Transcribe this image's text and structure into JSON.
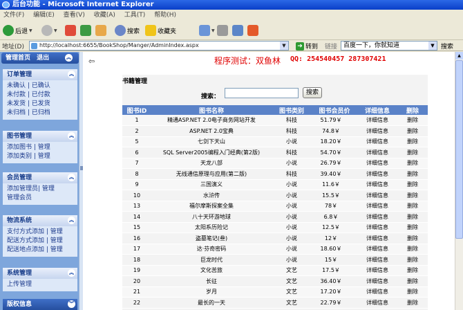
{
  "window": {
    "title": "后台功能 - Microsoft Internet Explorer"
  },
  "menu": [
    "文件(F)",
    "编辑(E)",
    "查看(V)",
    "收藏(A)",
    "工具(T)",
    "帮助(H)"
  ],
  "toolbar": {
    "back": "后退",
    "search": "搜索",
    "favorites": "收藏夹"
  },
  "address": {
    "label": "地址(D)",
    "url": "http://localhost:6655/BookShop/Manger/AdminIndex.aspx",
    "go": "转到",
    "links": "链接",
    "search_placeholder": "百度一下，你就知道",
    "search_btn": "搜索"
  },
  "sidebar": {
    "home": "管理首页",
    "logout": "退出",
    "groups": [
      {
        "title": "订单管理",
        "rows": [
          [
            "未确认",
            "已确认"
          ],
          [
            "未付款",
            "已付款"
          ],
          [
            "未发货",
            "已发货"
          ],
          [
            "未归档",
            "已归档"
          ]
        ]
      },
      {
        "title": "图书管理",
        "rows": [
          [
            "添加图书",
            "管理"
          ],
          [
            "添加类别",
            "管理"
          ]
        ]
      },
      {
        "title": "会员管理",
        "rows": [
          [
            "添加管理员",
            "管理"
          ],
          [
            "管理会员"
          ]
        ]
      },
      {
        "title": "物流系统",
        "rows": [
          [
            "支付方式添加",
            "管理"
          ],
          [
            "配送方式添加",
            "管理"
          ],
          [
            "配送地点添加",
            "管理"
          ]
        ]
      },
      {
        "title": "系统管理",
        "rows": [
          [
            "上传管理"
          ]
        ]
      },
      {
        "title": "版权信息",
        "rows": []
      }
    ]
  },
  "banner": {
    "left": "程序测试：双鱼林",
    "right": "QQ: 254540457 287307421"
  },
  "panel": {
    "title": "书籍管理",
    "search_label": "搜索：",
    "search_button": "搜索"
  },
  "table": {
    "headers": [
      "图书ID",
      "图书名称",
      "图书类别",
      "图书会员价",
      "详细信息",
      "删除"
    ],
    "rows": [
      [
        "1",
        "精通ASP.NET 2.0电子商务网站开发",
        "科技",
        "51.79￥",
        "详细信息",
        "删除"
      ],
      [
        "2",
        "ASP.NET 2.0宝典",
        "科技",
        "74.8￥",
        "详细信息",
        "删除"
      ],
      [
        "5",
        "七剑下天山",
        "小说",
        "18.20￥",
        "详细信息",
        "删除"
      ],
      [
        "6",
        "SQL Server2005编程入门经典(第2版)",
        "科技",
        "54.70￥",
        "详细信息",
        "删除"
      ],
      [
        "7",
        "天龙八部",
        "小说",
        "26.79￥",
        "详细信息",
        "删除"
      ],
      [
        "8",
        "无线通信原理与应用(第二版)",
        "科技",
        "39.40￥",
        "详细信息",
        "删除"
      ],
      [
        "9",
        "三国演义",
        "小说",
        "11.6￥",
        "详细信息",
        "删除"
      ],
      [
        "10",
        "水浒传",
        "小说",
        "15.5￥",
        "详细信息",
        "删除"
      ],
      [
        "13",
        "福尔摩斯探案全集",
        "小说",
        "78￥",
        "详细信息",
        "删除"
      ],
      [
        "14",
        "八十天环游地球",
        "小说",
        "6.8￥",
        "详细信息",
        "删除"
      ],
      [
        "15",
        "太阳系历险记",
        "小说",
        "12.5￥",
        "详细信息",
        "删除"
      ],
      [
        "16",
        "盗墓笔记(叁)",
        "小说",
        "12￥",
        "详细信息",
        "删除"
      ],
      [
        "17",
        "达·芬奇密码",
        "小说",
        "18.60￥",
        "详细信息",
        "删除"
      ],
      [
        "18",
        "巨龙时代",
        "小说",
        "15￥",
        "详细信息",
        "删除"
      ],
      [
        "19",
        "文化苦旅",
        "文艺",
        "17.5￥",
        "详细信息",
        "删除"
      ],
      [
        "20",
        "长征",
        "文艺",
        "36.40￥",
        "详细信息",
        "删除"
      ],
      [
        "21",
        "岁月",
        "文艺",
        "17.20￥",
        "详细信息",
        "删除"
      ],
      [
        "22",
        "最长的一天",
        "文艺",
        "22.79￥",
        "详细信息",
        "删除"
      ]
    ]
  }
}
